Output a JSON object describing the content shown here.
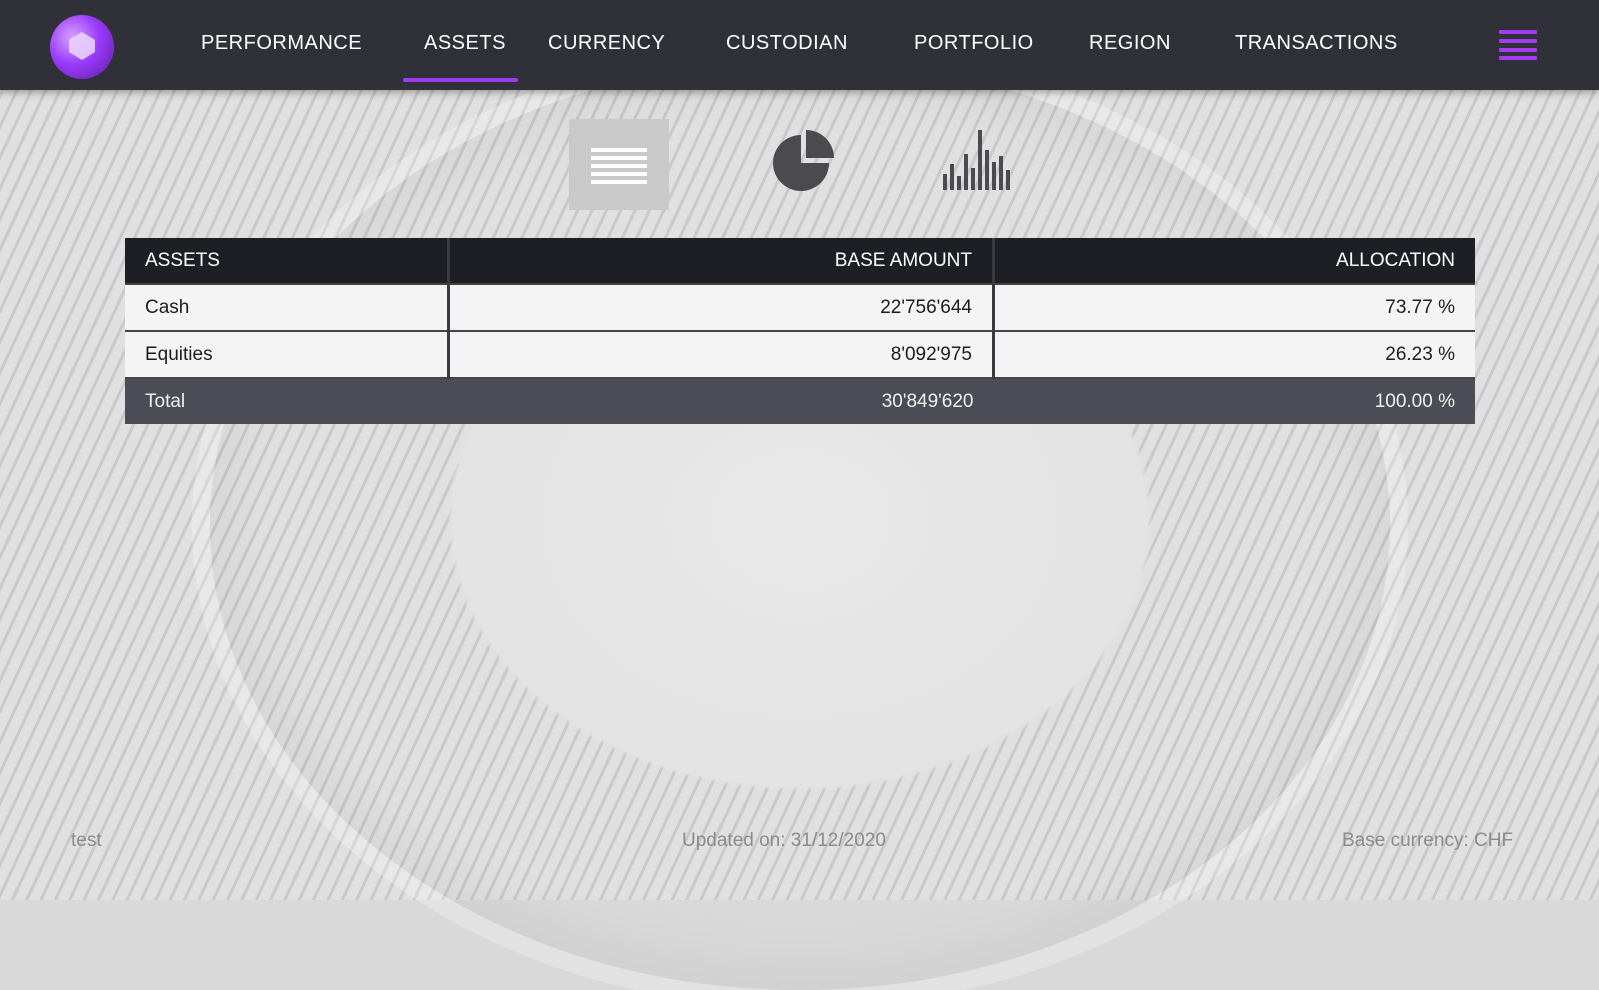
{
  "nav": {
    "items": [
      {
        "label": "PERFORMANCE"
      },
      {
        "label": "ASSETS",
        "active": true
      },
      {
        "label": "CURRENCY"
      },
      {
        "label": "CUSTODIAN"
      },
      {
        "label": "PORTFOLIO"
      },
      {
        "label": "REGION"
      },
      {
        "label": "TRANSACTIONS"
      }
    ],
    "accent_color": "#a23cf0",
    "menu_icon": "hamburger-menu-icon",
    "logo_icon": "gem-logo-icon"
  },
  "view_toggle": {
    "options": [
      {
        "icon": "table-list-icon",
        "selected": true
      },
      {
        "icon": "pie-chart-icon",
        "selected": false
      },
      {
        "icon": "bar-chart-icon",
        "selected": false
      }
    ]
  },
  "table": {
    "headers": {
      "assets": "ASSETS",
      "base_amount": "BASE AMOUNT",
      "allocation": "ALLOCATION"
    },
    "rows": [
      {
        "asset": "Cash",
        "amount": "22'756'644",
        "allocation": "73.77 %"
      },
      {
        "asset": "Equities",
        "amount": "8'092'975",
        "allocation": "26.23 %"
      }
    ],
    "total": {
      "label": "Total",
      "amount": "30'849'620",
      "allocation": "100.00 %"
    }
  },
  "footer": {
    "left": "test",
    "center": "Updated on: 31/12/2020",
    "right": "Base currency: CHF"
  }
}
